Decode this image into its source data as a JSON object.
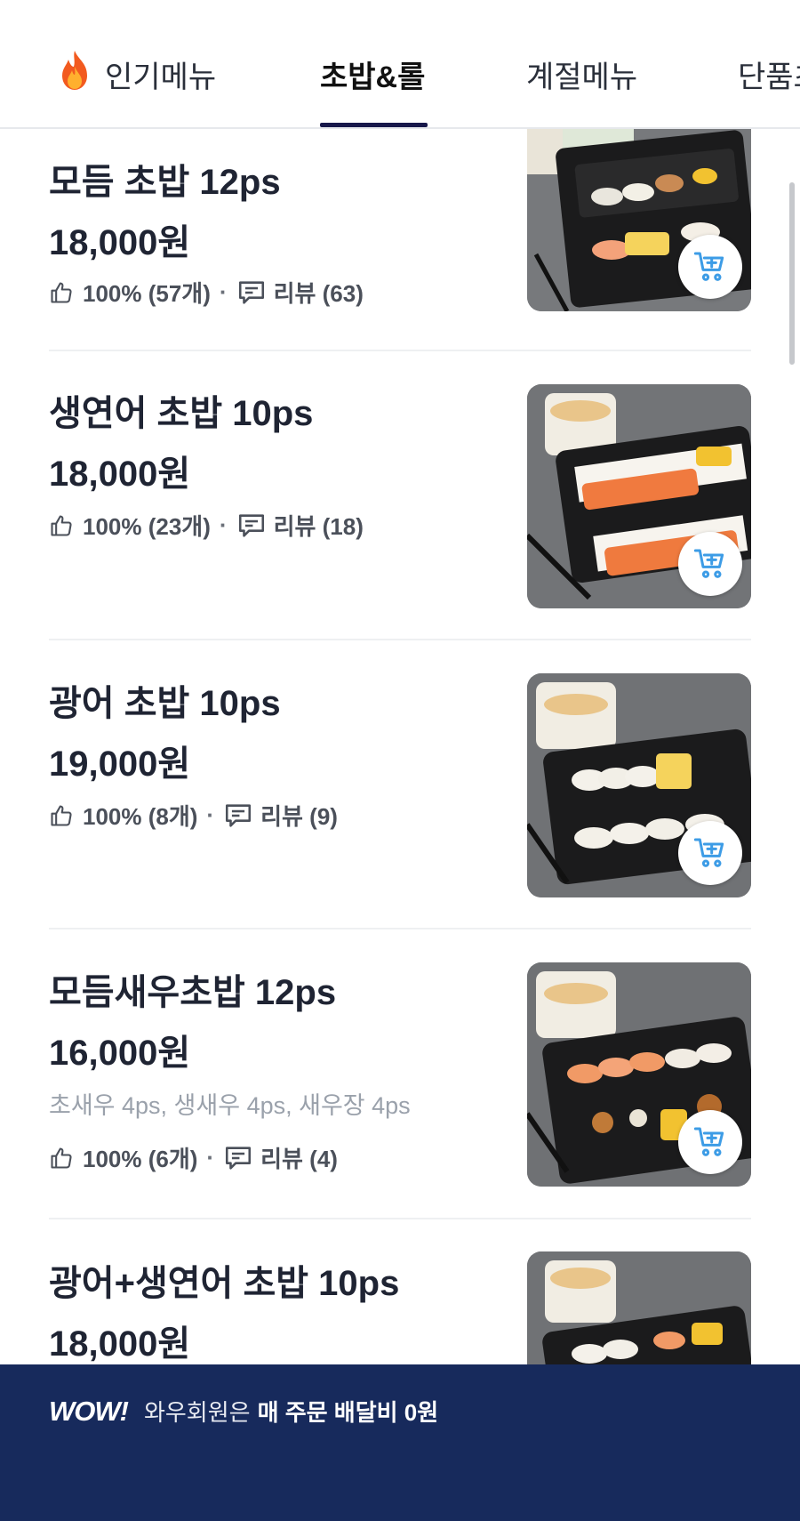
{
  "tabs": [
    {
      "label": "인기메뉴",
      "icon": "fire-icon"
    },
    {
      "label": "초밥&롤",
      "active": true
    },
    {
      "label": "계절메뉴"
    },
    {
      "label": "단품초"
    }
  ],
  "items": [
    {
      "name": "모듬 초밥 12ps",
      "price": "18,000원",
      "likes": "100% (57개)",
      "reviews": "리뷰 (63)"
    },
    {
      "name": "생연어 초밥 10ps",
      "price": "18,000원",
      "likes": "100% (23개)",
      "reviews": "리뷰 (18)"
    },
    {
      "name": "광어 초밥 10ps",
      "price": "19,000원",
      "likes": "100% (8개)",
      "reviews": "리뷰 (9)"
    },
    {
      "name": "모듬새우초밥 12ps",
      "price": "16,000원",
      "desc": "초새우 4ps, 생새우 4ps, 새우장 4ps",
      "likes": "100% (6개)",
      "reviews": "리뷰 (4)"
    },
    {
      "name": "광어+생연어 초밥 10ps",
      "price": "18,000원"
    }
  ],
  "separator": "·",
  "banner": {
    "logo": "WOW!",
    "text": "와우회원은",
    "strong": "매 주문 배달비 0원"
  },
  "colors": {
    "accent_underline": "#17184a",
    "banner_bg": "#172a5c",
    "cart_icon": "#3d9ce6",
    "text": "#1f2433",
    "muted": "#9aa1ab"
  }
}
